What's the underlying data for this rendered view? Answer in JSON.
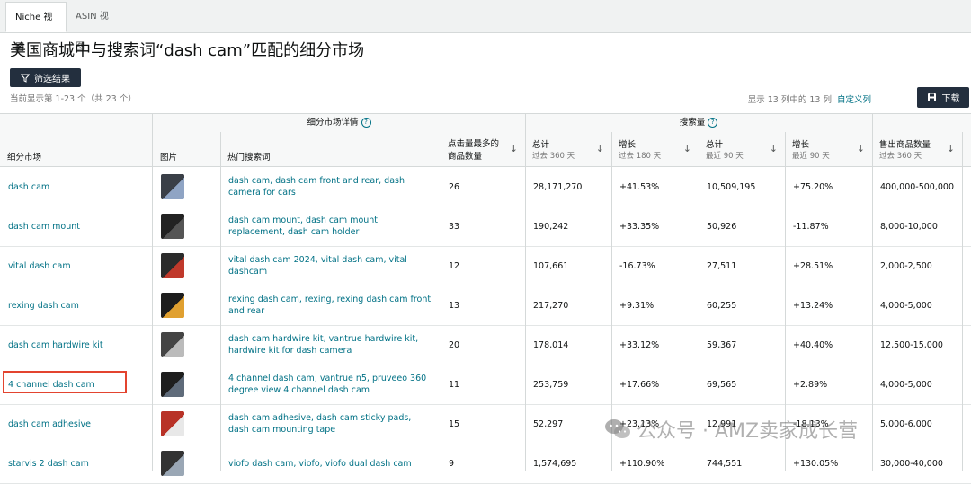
{
  "tabs": [
    {
      "label": "Niche 视图",
      "active": true
    },
    {
      "label": "ASIN 视图",
      "active": false
    }
  ],
  "title": "美国商城中与搜索词“dash cam”匹配的细分市场",
  "filter_button": "筛选结果",
  "count_text": "当前显示第 1-23 个（共 23 个）",
  "columns_info": "显示 13 列中的 13 列",
  "customize_link": "自定义列",
  "download_button": "下载",
  "group_headers": {
    "niche_details": "细分市场详情",
    "search_volume": "搜索量"
  },
  "headers": {
    "niche": "细分市场",
    "image": "图片",
    "top_terms": "热门搜索词",
    "clicked_products": "点击量最多的商品数量",
    "total": "总计",
    "total_sub": "过去 360 天",
    "growth": "增长",
    "growth_sub": "过去 180 天",
    "total90": "总计",
    "total90_sub": "最近 90 天",
    "growth90": "增长",
    "growth90_sub": "最近 90 天",
    "units_sold": "售出商品数量",
    "units_sold_sub": "过去 360 天"
  },
  "rows": [
    {
      "niche": "dash cam",
      "terms": "dash cam, dash cam front and rear, dash camera for cars",
      "products": "26",
      "total360": "28,171,270",
      "growth180": "+41.53%",
      "total90": "10,509,195",
      "growth90": "+75.20%",
      "units": "400,000-500,000"
    },
    {
      "niche": "dash cam mount",
      "terms": "dash cam mount, dash cam mount replacement, dash cam holder",
      "products": "33",
      "total360": "190,242",
      "growth180": "+33.35%",
      "total90": "50,926",
      "growth90": "-11.87%",
      "units": "8,000-10,000"
    },
    {
      "niche": "vital dash cam",
      "terms": "vital dash cam 2024, vital dash cam, vital dashcam",
      "products": "12",
      "total360": "107,661",
      "growth180": "-16.73%",
      "total90": "27,511",
      "growth90": "+28.51%",
      "units": "2,000-2,500"
    },
    {
      "niche": "rexing dash cam",
      "terms": "rexing dash cam, rexing, rexing dash cam front and rear",
      "products": "13",
      "total360": "217,270",
      "growth180": "+9.31%",
      "total90": "60,255",
      "growth90": "+13.24%",
      "units": "4,000-5,000"
    },
    {
      "niche": "dash cam hardwire kit",
      "terms": "dash cam hardwire kit, vantrue hardwire kit, hardwire kit for dash camera",
      "products": "20",
      "total360": "178,014",
      "growth180": "+33.12%",
      "total90": "59,367",
      "growth90": "+40.40%",
      "units": "12,500-15,000"
    },
    {
      "niche": "4 channel dash cam",
      "terms": "4 channel dash cam, vantrue n5, pruveeo 360 degree view 4 channel dash cam",
      "products": "11",
      "total360": "253,759",
      "growth180": "+17.66%",
      "total90": "69,565",
      "growth90": "+2.89%",
      "units": "4,000-5,000"
    },
    {
      "niche": "dash cam adhesive",
      "terms": "dash cam adhesive, dash cam sticky pads, dash cam mounting tape",
      "products": "15",
      "total360": "52,297",
      "growth180": "+23.13%",
      "total90": "12,991",
      "growth90": "-18.13%",
      "units": "5,000-6,000"
    },
    {
      "niche": "starvis 2 dash cam",
      "terms": "viofo dash cam, viofo, viofo dual dash cam",
      "products": "9",
      "total360": "1,574,695",
      "growth180": "+110.90%",
      "total90": "744,551",
      "growth90": "+130.05%",
      "units": "30,000-40,000"
    }
  ],
  "watermark": "公众号 · AMZ卖家成长营"
}
